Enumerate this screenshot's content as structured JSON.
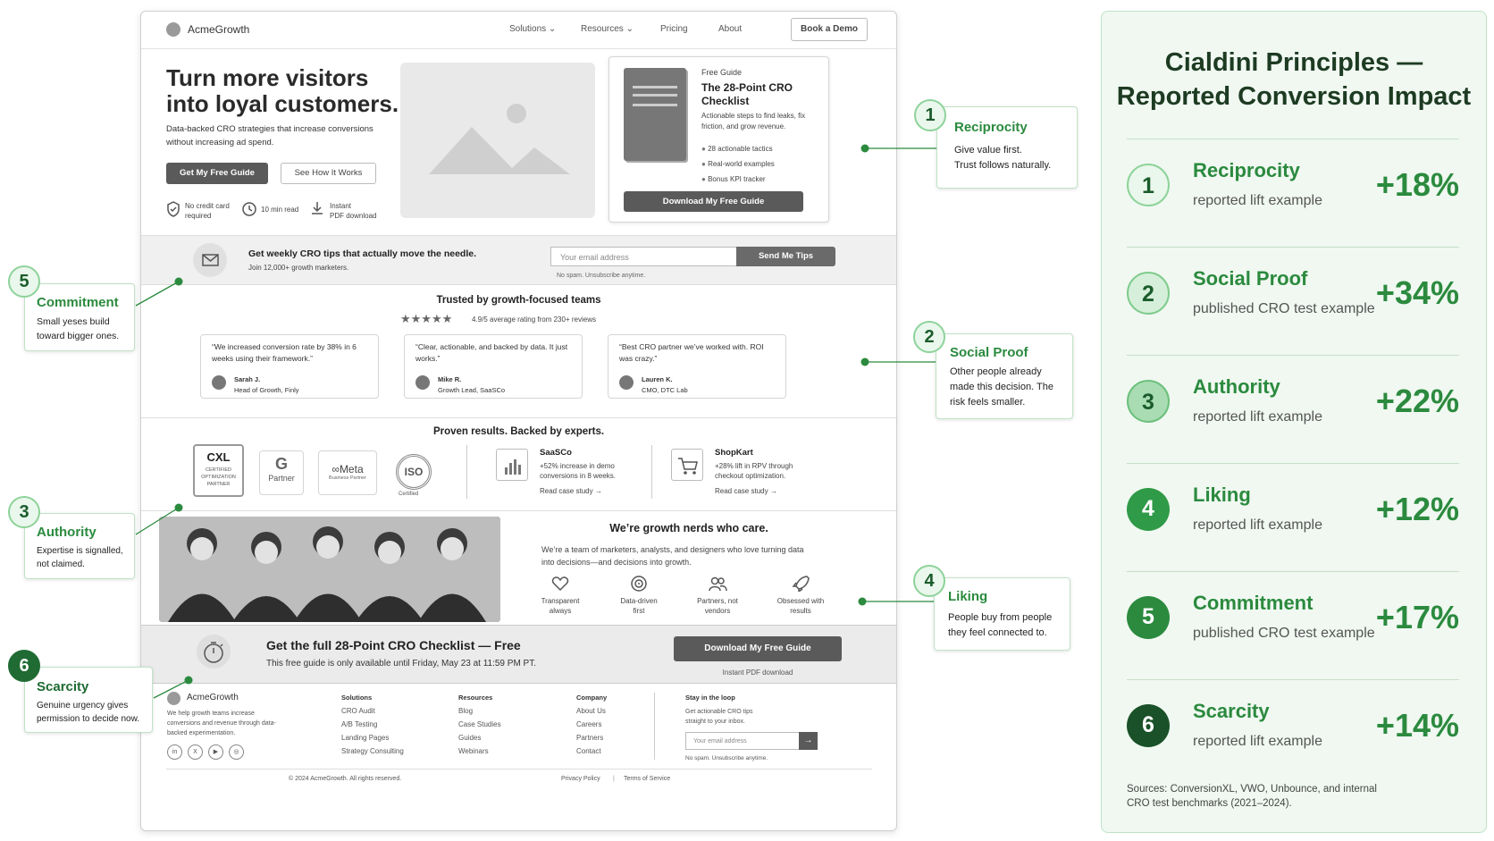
{
  "nav": {
    "brand": "AcmeGrowth",
    "links": [
      "Solutions",
      "Resources",
      "Pricing",
      "About"
    ],
    "cta": "Book a Demo"
  },
  "hero": {
    "title_line1": "Turn more visitors",
    "title_line2": "into loyal customers.",
    "subtitle": "Data-backed CRO strategies that increase conversions without increasing ad spend.",
    "primary_button": "Get My Free Guide",
    "secondary_button": "See How It Works",
    "badges": [
      {
        "icon": "shield-check-icon",
        "text_line1": "No credit card",
        "text_line2": "required"
      },
      {
        "icon": "clock-icon",
        "text_line1": "10 min read",
        "text_line2": ""
      },
      {
        "icon": "download-icon",
        "text_line1": "Instant",
        "text_line2": "PDF download"
      }
    ]
  },
  "guide": {
    "eyebrow": "Free Guide",
    "title_line1": "The 28-Point CRO",
    "title_line2": "Checklist",
    "description": "Actionable steps to find leaks, fix friction, and grow revenue.",
    "bullets": [
      "28 actionable tactics",
      "Real-world examples",
      "Bonus KPI tracker"
    ],
    "button": "Download My Free Guide"
  },
  "newsletter": {
    "heading": "Get weekly CRO tips that actually move the needle.",
    "subtext": "Join 12,000+ growth marketers.",
    "placeholder": "Your email address",
    "button": "Send Me Tips",
    "note": "No spam. Unsubscribe anytime."
  },
  "social": {
    "heading": "Trusted by growth-focused teams",
    "rating_text": "4.9/5 average rating from 230+ reviews",
    "stars": 5,
    "testimonials": [
      {
        "quote": "“We increased conversion rate by 38% in 6 weeks using their framework.”",
        "name": "Sarah J.",
        "role": "Head of Growth, Finly"
      },
      {
        "quote": "“Clear, actionable, and backed by data. It just works.”",
        "name": "Mike R.",
        "role": "Growth Lead, SaaSCo"
      },
      {
        "quote": "“Best CRO partner we’ve worked with. ROI was crazy.”",
        "name": "Lauren K.",
        "role": "CMO, DTC Lab"
      }
    ]
  },
  "authority": {
    "heading": "Proven results. Backed by experts.",
    "badges": {
      "cxl_title": "CXL",
      "cxl_sub": "CERTIFIED OPTIMIZATION PARTNER",
      "google": "Partner",
      "meta": "Meta",
      "meta_sub": "Business Partner",
      "iso": "ISO",
      "iso_sub": "Certified"
    },
    "cases": [
      {
        "company": "SaaSCo",
        "result": "+52% increase in demo conversions in 8 weeks.",
        "link": "Read case study"
      },
      {
        "company": "ShopKart",
        "result": "+28% lift in RPV through checkout optimization.",
        "link": "Read case study"
      }
    ]
  },
  "team": {
    "heading": "We’re growth nerds who care.",
    "text": "We’re a team of marketers, analysts, and designers who love turning data into decisions—and decisions into growth.",
    "values": [
      {
        "icon": "heart-icon",
        "line1": "Transparent",
        "line2": "always"
      },
      {
        "icon": "target-icon",
        "line1": "Data-driven",
        "line2": "first"
      },
      {
        "icon": "people-icon",
        "line1": "Partners, not",
        "line2": "vendors"
      },
      {
        "icon": "rocket-icon",
        "line1": "Obsessed with",
        "line2": "results"
      }
    ]
  },
  "urgency": {
    "heading": "Get the full 28-Point CRO Checklist — Free",
    "text": "This free guide is only available until Friday, May 23 at 11:59 PM PT.",
    "button": "Download My Free Guide",
    "note": "Instant PDF download"
  },
  "footer": {
    "brand": "AcmeGrowth",
    "blurb": "We help growth teams increase conversions and revenue through data-backed experimentation.",
    "columns": [
      {
        "title": "Solutions",
        "items": [
          "CRO Audit",
          "A/B Testing",
          "Landing Pages",
          "Strategy Consulting"
        ]
      },
      {
        "title": "Resources",
        "items": [
          "Blog",
          "Case Studies",
          "Guides",
          "Webinars"
        ]
      },
      {
        "title": "Company",
        "items": [
          "About Us",
          "Careers",
          "Partners",
          "Contact"
        ]
      }
    ],
    "newsletter_title": "Stay in the loop",
    "newsletter_text": "Get actionable CRO tips straight to your inbox.",
    "placeholder": "Your email address",
    "note": "No spam. Unsubscribe anytime.",
    "copyright": "© 2024 AcmeGrowth. All rights reserved.",
    "legal": [
      "Privacy Policy",
      "Terms of Service"
    ],
    "social": [
      "in",
      "X",
      "▶",
      "◎"
    ]
  },
  "callouts": [
    {
      "n": "1",
      "title": "Reciprocity",
      "line1": "Give value first.",
      "line2": "Trust follows naturally.",
      "line3": ""
    },
    {
      "n": "2",
      "title": "Social Proof",
      "line1": "Other people already",
      "line2": "made this decision. The",
      "line3": "risk feels smaller."
    },
    {
      "n": "3",
      "title": "Authority",
      "line1": "Expertise is signalled,",
      "line2": "not claimed.",
      "line3": ""
    },
    {
      "n": "4",
      "title": "Liking",
      "line1": "People buy from people",
      "line2": "they feel connected to.",
      "line3": ""
    },
    {
      "n": "5",
      "title": "Commitment",
      "line1": "Small yeses build",
      "line2": "toward bigger ones.",
      "line3": ""
    },
    {
      "n": "6",
      "title": "Scarcity",
      "line1": "Genuine urgency gives",
      "line2": "permission to decide now.",
      "line3": ""
    }
  ],
  "panel": {
    "title_line1": "Cialdini Principles —",
    "title_line2": "Reported Conversion Impact",
    "rows": [
      {
        "n": "1",
        "name": "Reciprocity",
        "sub": "reported lift example",
        "pct": "+18%"
      },
      {
        "n": "2",
        "name": "Social Proof",
        "sub": "published CRO test example",
        "pct": "+34%"
      },
      {
        "n": "3",
        "name": "Authority",
        "sub": "reported lift example",
        "pct": "+22%"
      },
      {
        "n": "4",
        "name": "Liking",
        "sub": "reported lift example",
        "pct": "+12%"
      },
      {
        "n": "5",
        "name": "Commitment",
        "sub": "published CRO test example",
        "pct": "+17%"
      },
      {
        "n": "6",
        "name": "Scarcity",
        "sub": "reported lift example",
        "pct": "+14%"
      }
    ],
    "sources_line1": "Sources: ConversionXL, VWO, Unbounce, and internal",
    "sources_line2": "CRO test benchmarks (2021–2024).",
    "colors": {
      "accent": "#2b8a3e",
      "light": "#eaf7ec",
      "dark": "#1f6b33"
    }
  }
}
